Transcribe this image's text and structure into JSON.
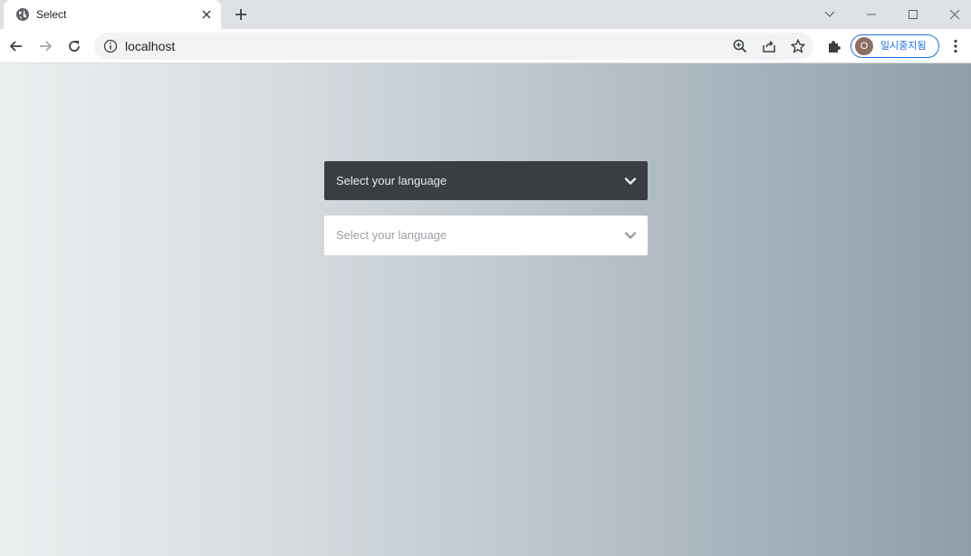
{
  "browser": {
    "tab": {
      "title": "Select"
    },
    "address": {
      "url": "localhost"
    },
    "profile": {
      "initial": "O",
      "label": "일시중지됨"
    }
  },
  "page": {
    "selects": [
      {
        "label": "Select your language",
        "theme": "dark"
      },
      {
        "label": "Select your language",
        "theme": "light"
      }
    ]
  },
  "colors": {
    "dark_select": "#3a3d42",
    "light_select": "#ffffff",
    "accent": "#1a73e8"
  }
}
